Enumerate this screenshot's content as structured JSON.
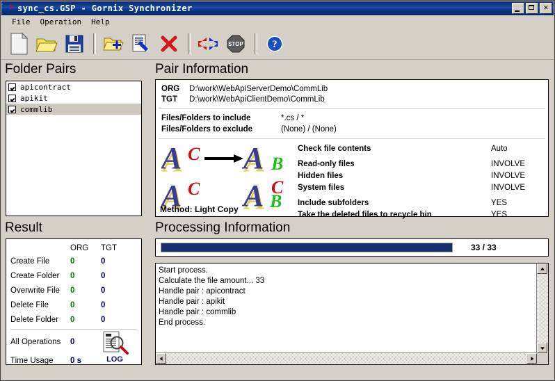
{
  "window": {
    "title": "sync_cs.GSP - Gornix Synchronizer",
    "icon": "sync-arrows-icon",
    "buttons": {
      "minimize": "minimize",
      "maximize": "maximize",
      "close": "✕"
    }
  },
  "menubar": {
    "items": [
      "File",
      "Operation",
      "Help"
    ]
  },
  "toolbar": {
    "buttons": [
      {
        "name": "new-file-button",
        "icon": "new-document-icon"
      },
      {
        "name": "open-button",
        "icon": "open-folder-icon"
      },
      {
        "name": "save-button",
        "icon": "floppy-disk-icon"
      },
      {
        "name": "add-pair-button",
        "icon": "folder-plus-icon"
      },
      {
        "name": "edit-pair-button",
        "icon": "document-pencil-icon"
      },
      {
        "name": "delete-pair-button",
        "icon": "red-x-icon"
      },
      {
        "name": "synchronize-button",
        "icon": "left-right-arrows-icon"
      },
      {
        "name": "stop-button",
        "icon": "stop-sign-icon"
      },
      {
        "name": "help-button",
        "icon": "blue-question-mark-icon"
      }
    ]
  },
  "folder_pairs": {
    "title": "Folder Pairs",
    "items": [
      {
        "label": "apicontract",
        "checked": true,
        "selected": false
      },
      {
        "label": "apikit",
        "checked": true,
        "selected": false
      },
      {
        "label": "commlib",
        "checked": true,
        "selected": true
      }
    ]
  },
  "pair_information": {
    "title": "Pair Information",
    "org_key": "ORG",
    "org_path": "D:\\work\\WebApiServerDemo\\CommLib",
    "tgt_key": "TGT",
    "tgt_path": "D:\\work\\WebApiClientDemo\\CommLib",
    "include_label": "Files/Folders to include",
    "include_value": "*.cs / *",
    "exclude_label": "Files/Folders to exclude",
    "exclude_value": "(None) / (None)",
    "method_label": "Method: Light Copy",
    "options": [
      {
        "label": "Check file contents",
        "value": "Auto"
      },
      {
        "label": "Read-only files",
        "value": "INVOLVE"
      },
      {
        "label": "Hidden files",
        "value": "INVOLVE"
      },
      {
        "label": "System files",
        "value": "INVOLVE"
      },
      {
        "label": "Include subfolders",
        "value": "YES"
      },
      {
        "label": "Take the deleted files to recycle bin",
        "value": "YES"
      }
    ]
  },
  "result": {
    "title": "Result",
    "col_org": "ORG",
    "col_tgt": "TGT",
    "rows": [
      {
        "label": "Create File",
        "org": "0",
        "tgt": "0"
      },
      {
        "label": "Create Folder",
        "org": "0",
        "tgt": "0"
      },
      {
        "label": "Overwrite File",
        "org": "0",
        "tgt": "0"
      },
      {
        "label": "Delete File",
        "org": "0",
        "tgt": "0"
      },
      {
        "label": "Delete Folder",
        "org": "0",
        "tgt": "0"
      }
    ],
    "all_operations_label": "All Operations",
    "all_operations_value": "0",
    "time_usage_label": "Time Usage",
    "time_usage_value": "0 s",
    "log_icon_label": "LOG",
    "colors": {
      "org": "#008000",
      "tgt": "#000080"
    }
  },
  "processing": {
    "title": "Processing Information",
    "progress_text": "33 / 33",
    "progress_percent": 100,
    "progress_color": "#1b2f6e",
    "log_lines": [
      "Start process.",
      "Calculate the file amount... 33",
      "Handle pair : apicontract",
      "Handle pair : apikit",
      "Handle pair : commlib",
      "End process."
    ]
  }
}
